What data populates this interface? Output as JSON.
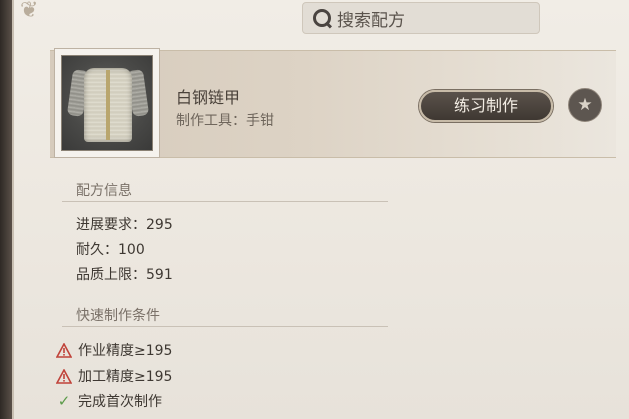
{
  "search": {
    "placeholder": "搜索配方"
  },
  "recipe": {
    "name": "白钢链甲",
    "tool": "制作工具：手钳",
    "practice_label": "练习制作"
  },
  "info": {
    "title": "配方信息",
    "lines": [
      "进展要求：295",
      "耐久：100",
      "品质上限：591"
    ]
  },
  "conditions": {
    "title": "快速制作条件",
    "items": [
      {
        "text": "作业精度≥195",
        "status": "warning"
      },
      {
        "text": "加工精度≥195",
        "status": "warning"
      },
      {
        "text": "完成首次制作",
        "status": "met"
      }
    ]
  },
  "colors": {
    "warning": "#c0433a",
    "met": "#5c9b4a",
    "button_bg": "#4a433d"
  },
  "icons": {
    "search": "search-icon",
    "favorite": "star-icon",
    "warning": "warning-triangle-icon",
    "met": "check-icon"
  }
}
